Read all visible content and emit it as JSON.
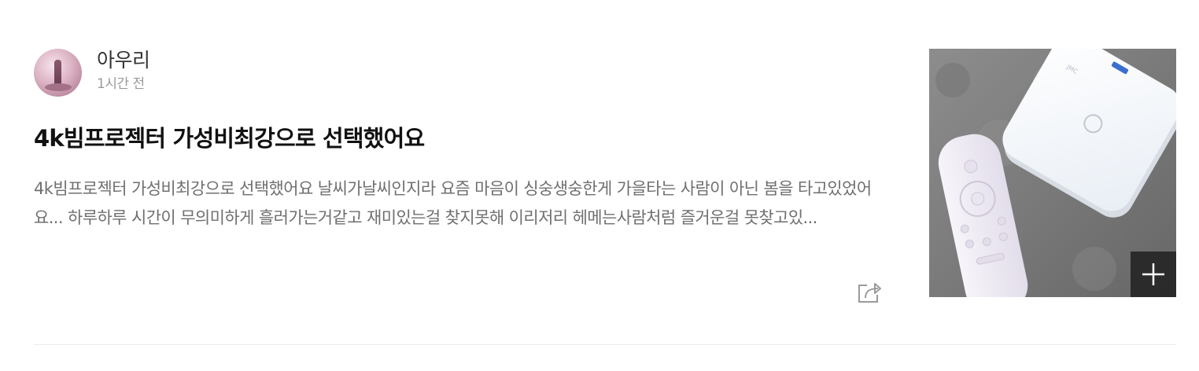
{
  "post": {
    "author": {
      "name": "아우리",
      "time": "1시간 전"
    },
    "title": "4k빔프로젝터 가성비최강으로 선택했어요",
    "excerpt": "4k빔프로젝터 가성비최강으로 선택했어요 날씨가날씨인지라 요즘 마음이 싱숭생숭한게 가을타는 사람이 아닌 봄을 타고있었어요... 하루하루 시간이 무의미하게 흘러가는거같고 재미있는걸 찾지못해 이리저리 헤메는사람처럼 즐거운걸 못찾고있...",
    "actions": {
      "share_icon": "share-icon",
      "add_icon": "plus-icon"
    }
  },
  "colors": {
    "title": "#111111",
    "excerpt": "#6f6f6f",
    "time": "#9a9a9a",
    "divider": "#ececec"
  }
}
